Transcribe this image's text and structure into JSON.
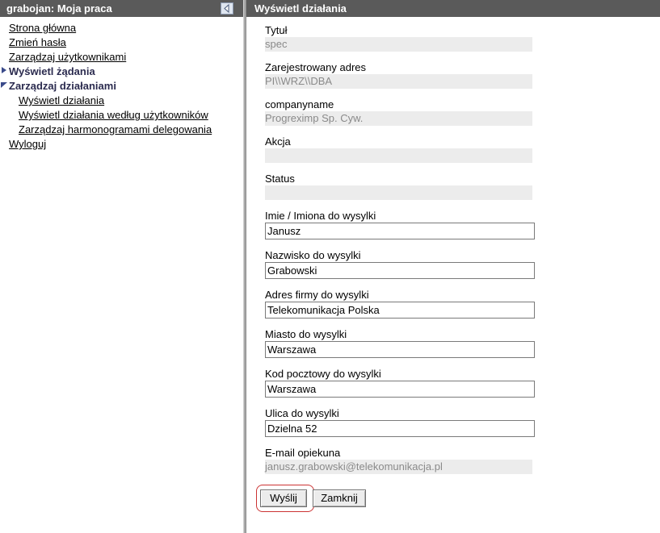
{
  "left_pane": {
    "title": "grabojan: Moja praca",
    "nav": [
      {
        "label": "Strona główna"
      },
      {
        "label": "Zmień hasła"
      },
      {
        "label": "Zarządzaj użytkownikami"
      },
      {
        "label": "Wyświetl żądania"
      },
      {
        "label": "Zarządzaj działaniami"
      },
      {
        "label": "Wyświetl działania"
      },
      {
        "label": "Wyświetl działania według użytkowników"
      },
      {
        "label": "Zarządzaj harmonogramami delegowania"
      },
      {
        "label": "Wyloguj"
      }
    ]
  },
  "right_pane": {
    "title": "Wyświetl działania",
    "readonly_fields": [
      {
        "label": "Tytuł",
        "value": "spec"
      },
      {
        "label": "Zarejestrowany adres",
        "value": "PI\\\\WRZ\\\\DBA"
      },
      {
        "label": "companyname",
        "value": "Progreximp Sp. Cyw."
      },
      {
        "label": "Akcja",
        "value": ""
      },
      {
        "label": "Status",
        "value": ""
      }
    ],
    "input_fields": [
      {
        "label": "Imie / Imiona do wysylki",
        "value": "Janusz"
      },
      {
        "label": "Nazwisko do wysylki",
        "value": "Grabowski"
      },
      {
        "label": "Adres firmy do wysylki",
        "value": "Telekomunikacja Polska"
      },
      {
        "label": "Miasto do wysylki",
        "value": "Warszawa"
      },
      {
        "label": "Kod pocztowy do wysylki",
        "value": "Warszawa"
      },
      {
        "label": "Ulica do wysylki",
        "value": "Dzielna 52"
      }
    ],
    "email": {
      "label": "E-mail opiekuna",
      "value": "janusz.grabowski@telekomunikacja.pl"
    },
    "buttons": {
      "submit": "Wyślij",
      "close": "Zamknij"
    }
  },
  "colors": {
    "header_bg": "#5a5a5a",
    "highlight": "#cc3333",
    "readonly_bg": "#ececec"
  },
  "icons": {
    "collapse": "collapse-left-icon",
    "nav_marker": "triangle-icon"
  }
}
